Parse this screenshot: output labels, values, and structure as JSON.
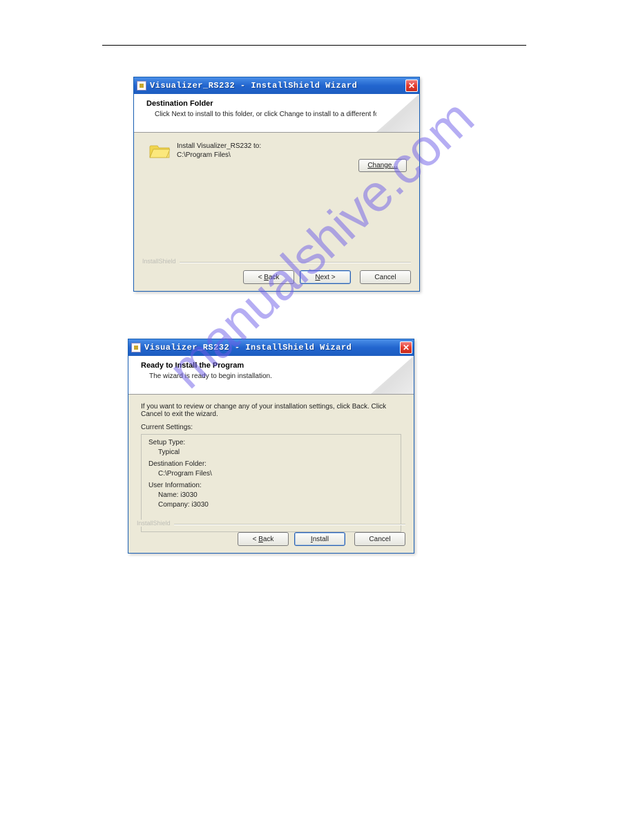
{
  "watermark": "manualshive.com",
  "dialog1": {
    "title": "Visualizer_RS232 - InstallShield Wizard",
    "header_title": "Destination Folder",
    "header_subtitle": "Click Next to install to this folder, or click Change to install to a different folder.",
    "install_line1": "Install Visualizer_RS232 to:",
    "install_line2": "C:\\Program Files\\",
    "change_btn": "Change...",
    "brand": "InstallShield",
    "back_btn": "< Back",
    "next_btn": "Next >",
    "cancel_btn": "Cancel",
    "close_tooltip": "Close"
  },
  "dialog2": {
    "title": "Visualizer_RS232 - InstallShield Wizard",
    "header_title": "Ready to Install the Program",
    "header_subtitle": "The wizard is ready to begin installation.",
    "review_text": "If you want to review or change any of your installation settings, click Back. Click Cancel to exit the wizard.",
    "current_settings_label": "Current Settings:",
    "setup_type_label": "Setup Type:",
    "setup_type_value": "Typical",
    "dest_folder_label": "Destination Folder:",
    "dest_folder_value": "C:\\Program Files\\",
    "user_info_label": "User Information:",
    "user_name": "Name: i3030",
    "user_company": "Company: i3030",
    "brand": "InstallShield",
    "back_btn": "< Back",
    "install_btn": "Install",
    "cancel_btn": "Cancel",
    "close_tooltip": "Close"
  }
}
